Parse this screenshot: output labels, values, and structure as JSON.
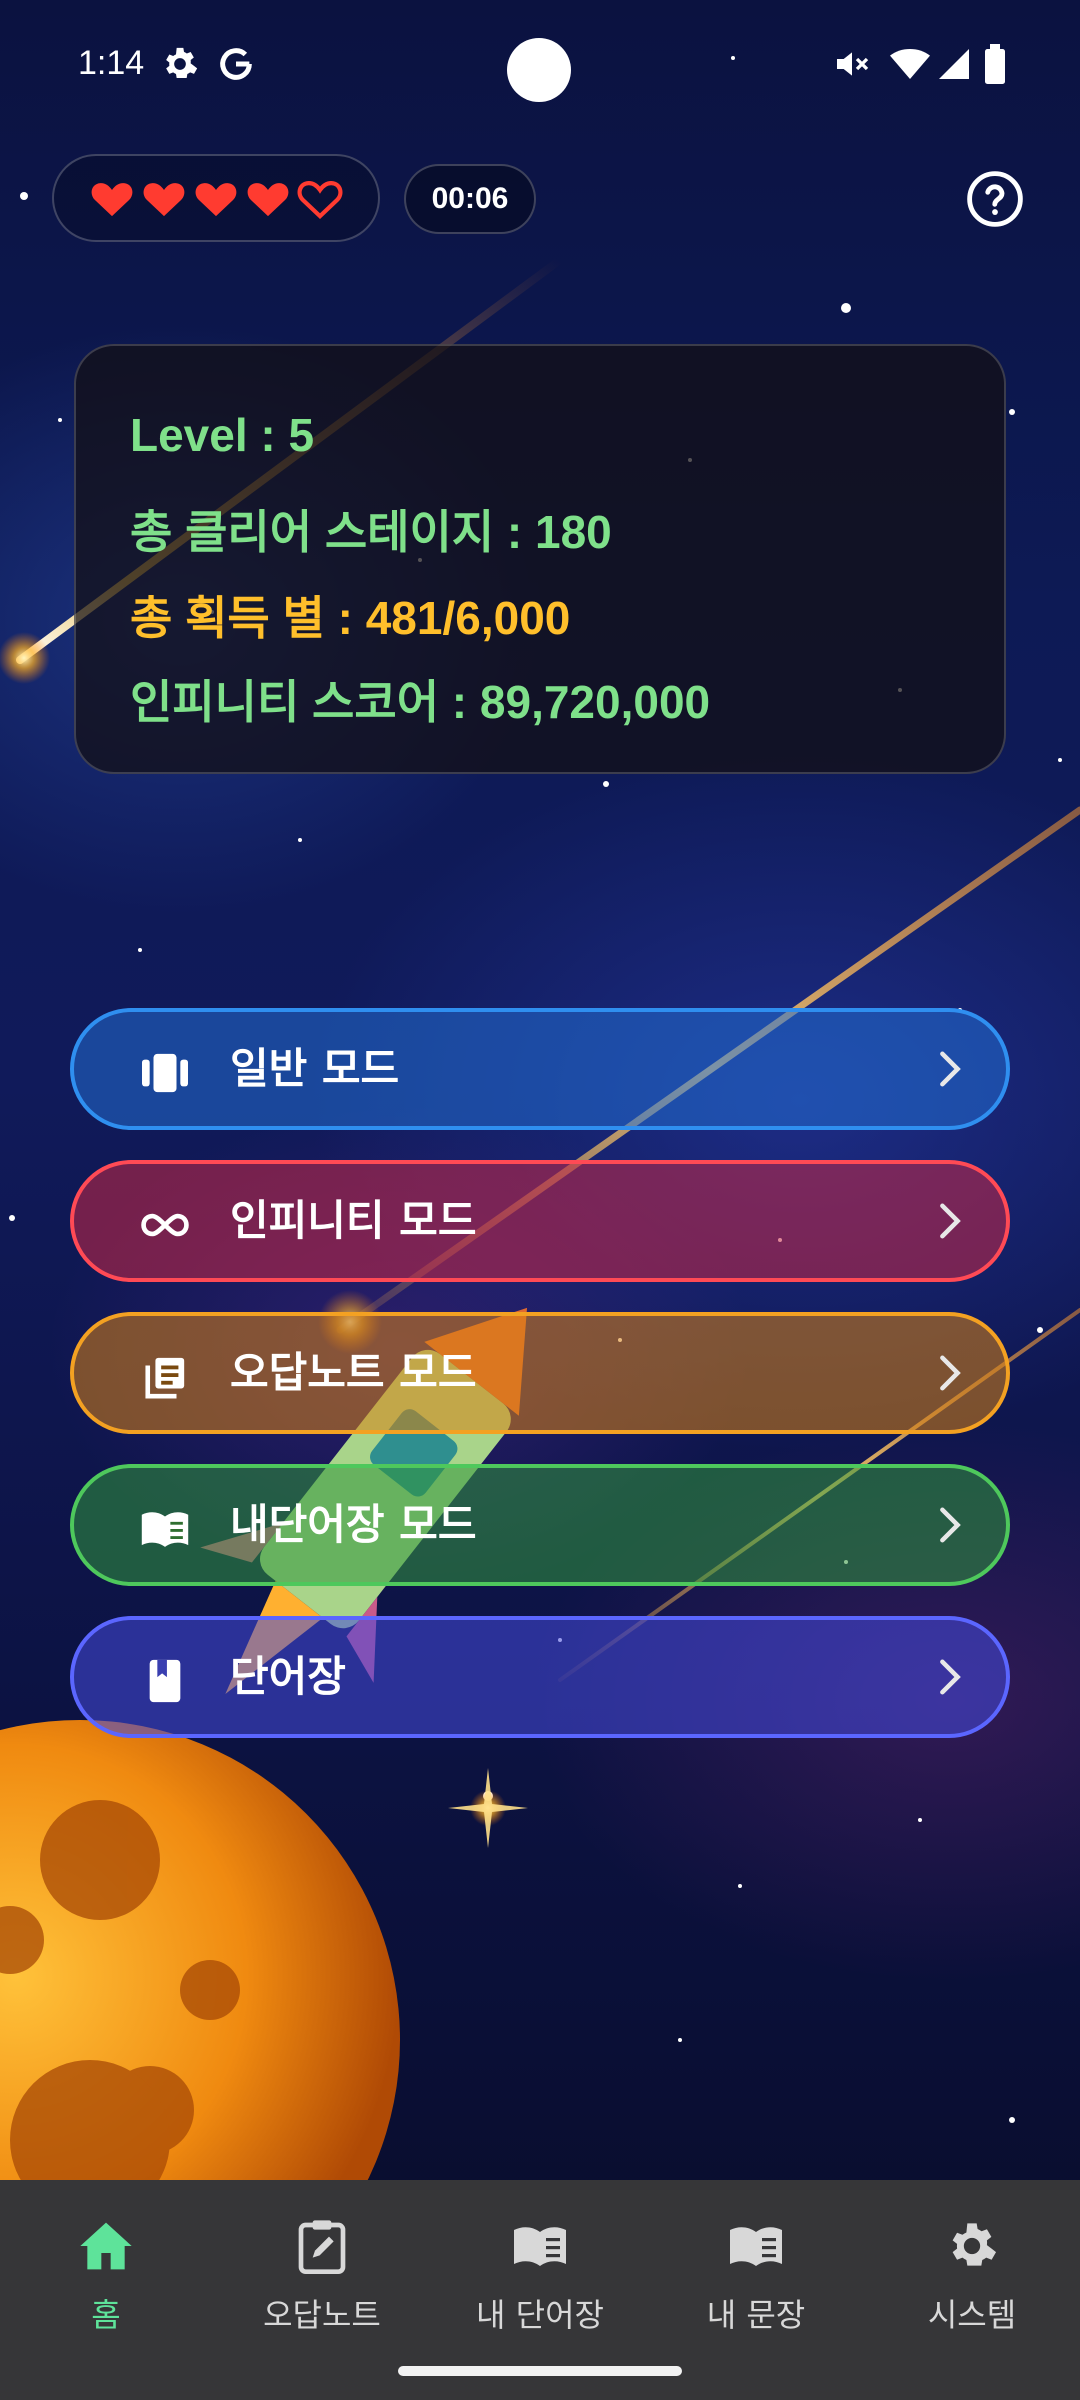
{
  "status_bar": {
    "time": "1:14",
    "icons": [
      "settings-icon",
      "google-icon",
      "mute-icon",
      "wifi-icon",
      "signal-icon",
      "battery-icon"
    ]
  },
  "header": {
    "hearts": {
      "filled": 4,
      "total": 5,
      "color": "#ff3b30"
    },
    "timer": "00:06",
    "help_icon": "help-circle-icon"
  },
  "stats": {
    "level": "Level : 5",
    "cleared_stages": "총 클리어 스테이지 : 180",
    "stars": "총 획득 별 : 481/6,000",
    "infinity_score": "인피니티 스코어 : 89,720,000"
  },
  "modes": [
    {
      "label": "일반 모드",
      "icon": "cards-icon",
      "border": "#2f8ff0",
      "fill": "rgba(35,110,210,0.55)"
    },
    {
      "label": "인피니티 모드",
      "icon": "infinity-icon",
      "border": "#ff4a55",
      "fill": "rgba(200,40,70,0.55)"
    },
    {
      "label": "오답노트 모드",
      "icon": "notes-icon",
      "border": "#f3a122",
      "fill": "rgba(215,130,20,0.55)"
    },
    {
      "label": "내단어장 모드",
      "icon": "open-book-icon",
      "border": "#4ec85c",
      "fill": "rgba(50,150,60,0.55)"
    },
    {
      "label": "단어장",
      "icon": "book-icon",
      "border": "#5b66ff",
      "fill": "rgba(70,75,220,0.55)"
    }
  ],
  "nav": {
    "items": [
      {
        "label": "홈",
        "icon": "home-icon",
        "active": true
      },
      {
        "label": "오답노트",
        "icon": "clipboard-edit-icon",
        "active": false
      },
      {
        "label": "내 단어장",
        "icon": "open-book-icon",
        "active": false
      },
      {
        "label": "내 문장",
        "icon": "open-book-icon",
        "active": false
      },
      {
        "label": "시스템",
        "icon": "gear-icon",
        "active": false
      }
    ],
    "active_color": "#5ee39a"
  }
}
